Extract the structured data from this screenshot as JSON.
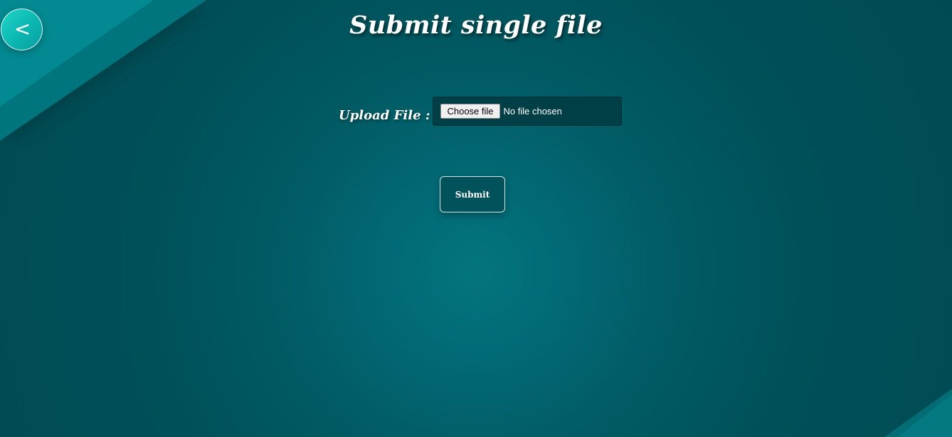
{
  "header": {
    "back_label": "<",
    "title": "Submit single file"
  },
  "upload": {
    "label": "Upload File :",
    "button_label": "Choose file",
    "status": "No file chosen"
  },
  "actions": {
    "submit_label": "Submit"
  },
  "colors": {
    "background_center": "#03757f",
    "background_edge": "#004b53",
    "accent_back_button": "#19c8c0",
    "file_box": "#003f46",
    "submit_button": "#02525b"
  },
  "icons": {
    "back": "chevron-left-icon"
  }
}
